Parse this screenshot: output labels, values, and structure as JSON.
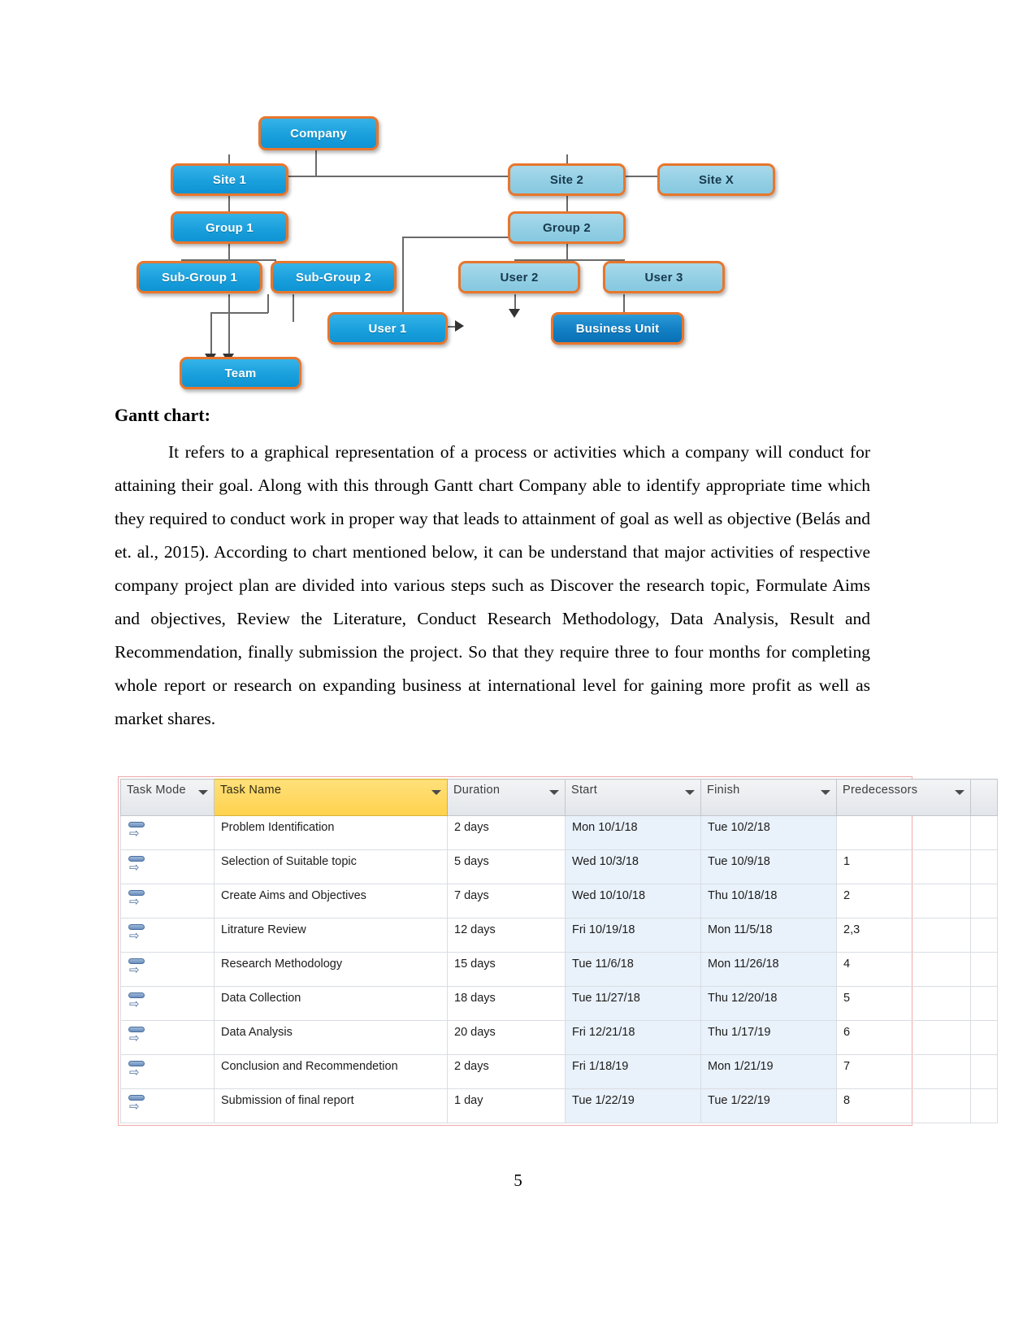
{
  "document": {
    "heading": "Gantt chart:",
    "paragraph": "It refers to a graphical representation of a process or activities which a company will conduct for attaining their goal. Along with this through Gantt chart Company able to identify appropriate time which they required to conduct work in proper way that leads to attainment of goal as well as objective (Belás and et. al., 2015). According to chart mentioned below, it can be understand that major activities of respective company project plan are divided into various steps such as Discover the research topic, Formulate Aims and objectives, Review the Literature, Conduct Research Methodology, Data Analysis, Result and Recommendation, finally submission the project. So that they require three to four months for completing whole report or research on expanding business at international level for gaining more profit as well as market shares.",
    "page_number": "5"
  },
  "org_diagram": {
    "colors": {
      "node_fill": "#1aa0dd",
      "node_fill_pale": "#93cfe4",
      "node_fill_dark": "#127fc4",
      "node_border": "#e8762c",
      "connector": "#6a6a6a"
    },
    "nodes": [
      {
        "id": "company",
        "label": "Company"
      },
      {
        "id": "site1",
        "label": "Site 1"
      },
      {
        "id": "site2",
        "label": "Site 2"
      },
      {
        "id": "sitex",
        "label": "Site X"
      },
      {
        "id": "group1",
        "label": "Group 1"
      },
      {
        "id": "group2",
        "label": "Group 2"
      },
      {
        "id": "subgroup1",
        "label": "Sub-Group 1"
      },
      {
        "id": "subgroup2",
        "label": "Sub-Group 2"
      },
      {
        "id": "user2",
        "label": "User 2"
      },
      {
        "id": "user3",
        "label": "User 3"
      },
      {
        "id": "user1",
        "label": "User 1"
      },
      {
        "id": "businessunit",
        "label": "Business Unit"
      },
      {
        "id": "team",
        "label": "Team"
      }
    ]
  },
  "gantt_table": {
    "columns": [
      {
        "key": "task_mode",
        "label": "Task Mode",
        "filter": true
      },
      {
        "key": "task_name",
        "label": "Task Name",
        "filter": true,
        "highlight": true
      },
      {
        "key": "duration",
        "label": "Duration",
        "filter": true
      },
      {
        "key": "start",
        "label": "Start",
        "filter": true
      },
      {
        "key": "finish",
        "label": "Finish",
        "filter": true
      },
      {
        "key": "predecessors",
        "label": "Predecessors",
        "filter": true
      }
    ],
    "rows": [
      {
        "task_name": "Problem Identification",
        "duration": "2 days",
        "start": "Mon 10/1/18",
        "finish": "Tue 10/2/18",
        "predecessors": ""
      },
      {
        "task_name": "Selection of Suitable topic",
        "duration": "5 days",
        "start": "Wed 10/3/18",
        "finish": "Tue 10/9/18",
        "predecessors": "1"
      },
      {
        "task_name": "Create Aims and Objectives",
        "duration": "7 days",
        "start": "Wed 10/10/18",
        "finish": "Thu 10/18/18",
        "predecessors": "2"
      },
      {
        "task_name": "Litrature Review",
        "duration": "12 days",
        "start": "Fri 10/19/18",
        "finish": "Mon 11/5/18",
        "predecessors": "2,3"
      },
      {
        "task_name": "Research Methodology",
        "duration": "15 days",
        "start": "Tue 11/6/18",
        "finish": "Mon 11/26/18",
        "predecessors": "4"
      },
      {
        "task_name": "Data Collection",
        "duration": "18 days",
        "start": "Tue 11/27/18",
        "finish": "Thu 12/20/18",
        "predecessors": "5"
      },
      {
        "task_name": "Data Analysis",
        "duration": "20 days",
        "start": "Fri 12/21/18",
        "finish": "Thu 1/17/19",
        "predecessors": "6"
      },
      {
        "task_name": "Conclusion and Recommendetion",
        "duration": "2 days",
        "start": "Fri 1/18/19",
        "finish": "Mon 1/21/19",
        "predecessors": "7"
      },
      {
        "task_name": "Submission of final report",
        "duration": "1 day",
        "start": "Tue 1/22/19",
        "finish": "Tue 1/22/19",
        "predecessors": "8"
      }
    ]
  }
}
